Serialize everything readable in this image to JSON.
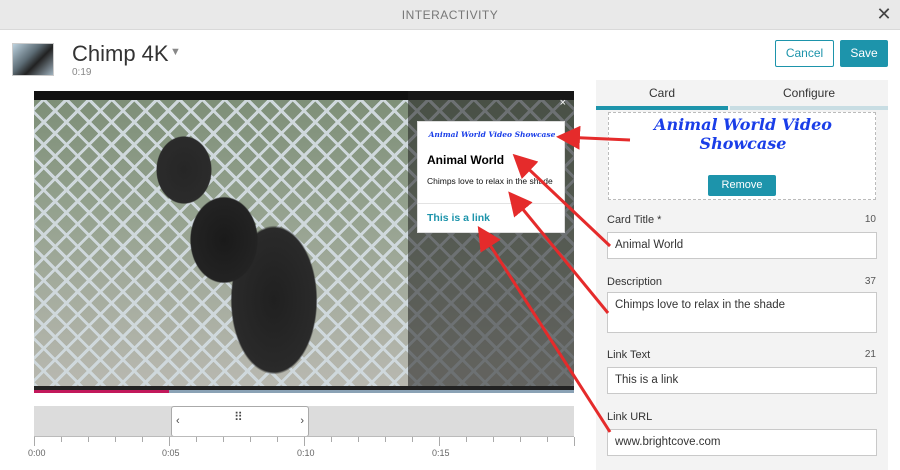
{
  "header": {
    "title": "INTERACTIVITY"
  },
  "video": {
    "title": "Chimp 4K",
    "duration": "0:19",
    "playback_progress": 0.25
  },
  "actions": {
    "cancel_label": "Cancel",
    "save_label": "Save"
  },
  "card_preview": {
    "close": "×",
    "banner": "Animal World Video Showcase",
    "title": "Animal World",
    "description": "Chimps love to relax in the shade",
    "link": "This is a link"
  },
  "timeline": {
    "labels": [
      "0:00",
      "0:05",
      "0:10",
      "0:15"
    ],
    "handle_left": "‹",
    "handle_right": "›",
    "handle_grip": "⠿"
  },
  "panel": {
    "tabs": [
      {
        "label": "Card",
        "active": true
      },
      {
        "label": "Configure",
        "active": false
      }
    ],
    "image_banner": "Animal World Video Showcase",
    "remove_label": "Remove",
    "fields": {
      "title": {
        "label": "Card Title *",
        "count": "10",
        "value": "Animal World"
      },
      "description": {
        "label": "Description",
        "count": "37",
        "value": "Chimps love to relax in the shade"
      },
      "link_text": {
        "label": "Link Text",
        "count": "21",
        "value": "This is a link"
      },
      "link_url": {
        "label": "Link URL",
        "value": "www.brightcove.com"
      }
    }
  },
  "colors": {
    "accent": "#1d94ab",
    "annotation_arrow": "#e52b2b",
    "progress": "#c2185b"
  }
}
